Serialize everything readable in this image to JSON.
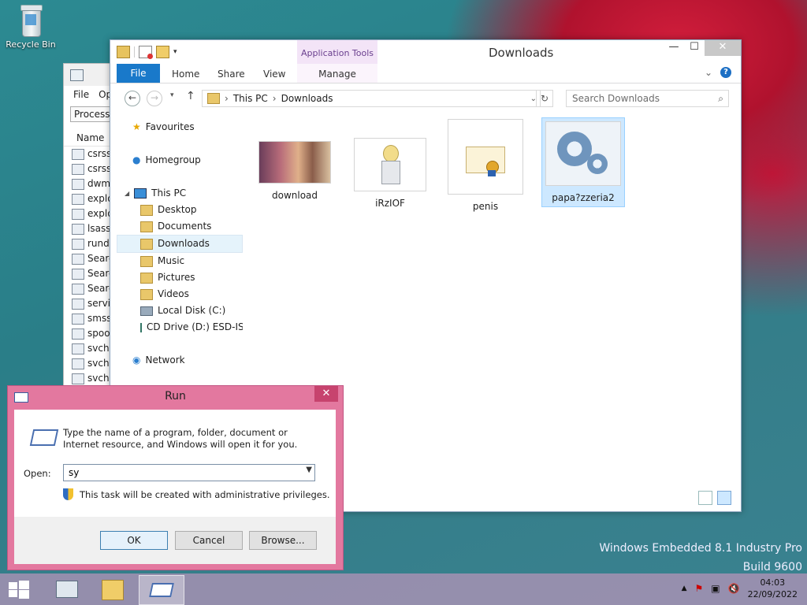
{
  "desktop": {
    "recycle_bin": "Recycle Bin"
  },
  "taskmgr": {
    "menu": [
      "File",
      "Op"
    ],
    "tab": "Processe",
    "column": "Name",
    "processes": [
      "csrss.",
      "csrss.",
      "dwm.",
      "explor",
      "explor",
      "lsass.e",
      "rundll",
      "Searcl",
      "Searcl",
      "Searcl",
      "servic",
      "smss.",
      "spool",
      "svcho",
      "svcho",
      "svcho"
    ]
  },
  "explorer": {
    "title": "Downloads",
    "app_tools": "Application Tools",
    "ribbon": {
      "file": "File",
      "home": "Home",
      "share": "Share",
      "view": "View",
      "manage": "Manage"
    },
    "address": {
      "root": "This PC",
      "current": "Downloads"
    },
    "search_placeholder": "Search Downloads",
    "nav": {
      "favourites": "Favourites",
      "homegroup": "Homegroup",
      "this_pc": "This PC",
      "desktop": "Desktop",
      "documents": "Documents",
      "downloads": "Downloads",
      "music": "Music",
      "pictures": "Pictures",
      "videos": "Videos",
      "local_disk": "Local Disk (C:)",
      "cd_drive": "CD Drive (D:) ESD-IS",
      "network": "Network"
    },
    "files": [
      {
        "name": "download"
      },
      {
        "name": "iRzIOF"
      },
      {
        "name": "penis"
      },
      {
        "name": "papa?zzeria2"
      }
    ]
  },
  "run": {
    "title": "Run",
    "description": "Type the name of a program, folder, document or Internet resource, and Windows will open it for you.",
    "open_label": "Open:",
    "open_value": "sy",
    "admin_note": "This task will be created with administrative privileges.",
    "ok": "OK",
    "cancel": "Cancel",
    "browse": "Browse..."
  },
  "watermark": {
    "line1": "Windows Embedded 8.1 Industry Pro",
    "line2": "Build 9600"
  },
  "clock": {
    "time": "04:03",
    "date": "22/09/2022"
  }
}
